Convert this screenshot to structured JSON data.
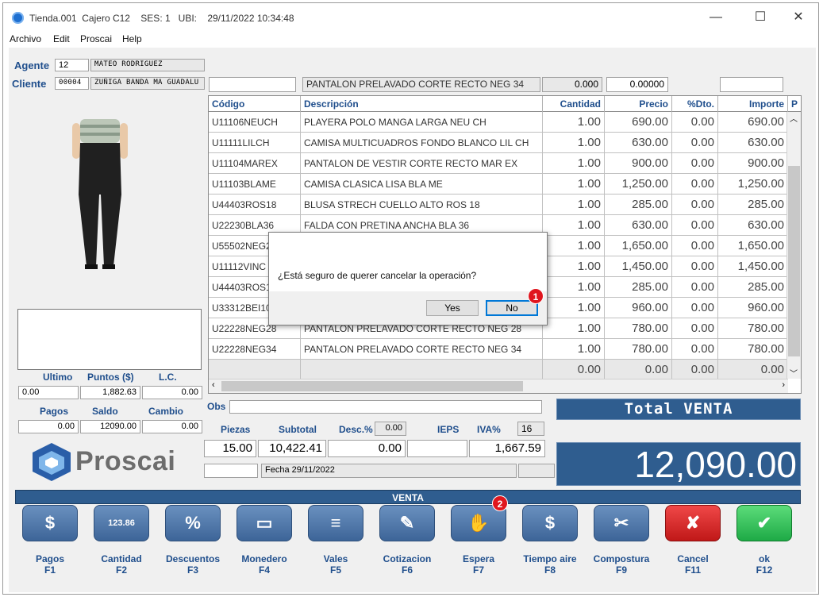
{
  "window": {
    "title": "Tienda.001  Cajero C12    SES: 1   UBI:    29/11/2022 10:34:48",
    "minimize": "—",
    "maximize": "☐",
    "close": "✕"
  },
  "menu": [
    "Archivo",
    "Edit",
    "Proscai",
    "Help"
  ],
  "agente": {
    "label": "Agente",
    "code": "12",
    "name": "MATEO RODRIGUEZ"
  },
  "cliente": {
    "label": "Cliente",
    "code": "00004",
    "name": "ZUÑIGA BANDA MA GUADALU"
  },
  "entry": {
    "code_value": "",
    "description": "PANTALON PRELAVADO CORTE RECTO NEG 34",
    "qty": "0.000",
    "price": "0.00000",
    "extra": ""
  },
  "grid": {
    "headers": [
      "Código",
      "Descripción",
      "Cantidad",
      "Precio",
      "%Dto.",
      "Importe",
      "P"
    ],
    "rows": [
      {
        "code": "U11106NEUCH",
        "desc": "PLAYERA POLO MANGA LARGA NEU CH",
        "qty": "1.00",
        "price": "690.00",
        "dto": "0.00",
        "imp": "690.00"
      },
      {
        "code": "U11111LILCH",
        "desc": "CAMISA MULTICUADROS FONDO BLANCO LIL CH",
        "qty": "1.00",
        "price": "630.00",
        "dto": "0.00",
        "imp": "630.00"
      },
      {
        "code": "U11104MAREX",
        "desc": "PANTALON DE VESTIR CORTE RECTO MAR EX",
        "qty": "1.00",
        "price": "900.00",
        "dto": "0.00",
        "imp": "900.00"
      },
      {
        "code": "U11103BLAME",
        "desc": "CAMISA CLASICA LISA BLA ME",
        "qty": "1.00",
        "price": "1,250.00",
        "dto": "0.00",
        "imp": "1,250.00"
      },
      {
        "code": "U44403ROS18",
        "desc": "BLUSA STRECH CUELLO ALTO ROS 18",
        "qty": "1.00",
        "price": "285.00",
        "dto": "0.00",
        "imp": "285.00"
      },
      {
        "code": "U22230BLA36",
        "desc": "FALDA CON PRETINA ANCHA BLA 36",
        "qty": "1.00",
        "price": "630.00",
        "dto": "0.00",
        "imp": "630.00"
      },
      {
        "code": "U55502NEG2",
        "desc": "",
        "qty": "1.00",
        "price": "1,650.00",
        "dto": "0.00",
        "imp": "1,650.00"
      },
      {
        "code": "U11112VINC",
        "desc": "",
        "qty": "1.00",
        "price": "1,450.00",
        "dto": "0.00",
        "imp": "1,450.00"
      },
      {
        "code": "U44403ROS1",
        "desc": "",
        "qty": "1.00",
        "price": "285.00",
        "dto": "0.00",
        "imp": "285.00"
      },
      {
        "code": "U33312BEI10",
        "desc": "",
        "qty": "1.00",
        "price": "960.00",
        "dto": "0.00",
        "imp": "960.00"
      },
      {
        "code": "U22228NEG28",
        "desc": "PANTALON PRELAVADO CORTE RECTO NEG 28",
        "qty": "1.00",
        "price": "780.00",
        "dto": "0.00",
        "imp": "780.00"
      },
      {
        "code": "U22228NEG34",
        "desc": "PANTALON PRELAVADO CORTE RECTO NEG 34",
        "qty": "1.00",
        "price": "780.00",
        "dto": "0.00",
        "imp": "780.00"
      },
      {
        "code": "",
        "desc": "",
        "qty": "0.00",
        "price": "0.00",
        "dto": "0.00",
        "imp": "0.00"
      }
    ]
  },
  "dialog": {
    "message": "¿Está seguro de querer cancelar la operación?",
    "yes": "Yes",
    "no": "No",
    "badge": "1"
  },
  "stats": {
    "ultimo_label": "Ultimo",
    "puntos_label": "Puntos ($)",
    "lc_label": "L.C.",
    "ultimo": "0.00",
    "puntos": "1,882.63",
    "lc": "0.00",
    "pagos_label": "Pagos",
    "saldo_label": "Saldo",
    "cambio_label": "Cambio",
    "pagos": "0.00",
    "saldo": "12090.00",
    "cambio": "0.00"
  },
  "obs_label": "Obs",
  "summary": {
    "piezas_label": "Piezas",
    "subtotal_label": "Subtotal",
    "desc_label": "Desc.%",
    "ieps_label": "IEPS",
    "iva_label": "IVA%",
    "desc_pct": "0.00",
    "iva_pct": "16",
    "piezas": "15.00",
    "subtotal": "10,422.41",
    "descuento": "0.00",
    "ieps": "",
    "iva": "1,667.59",
    "fecha": "Fecha 29/11/2022"
  },
  "total": {
    "title": "Total VENTA",
    "value": "12,090.00"
  },
  "logo_text": "Proscai",
  "venta_bar": "VENTA",
  "function_buttons": [
    {
      "label": "Pagos",
      "key": "F1",
      "icon": "$"
    },
    {
      "label": "Cantidad",
      "key": "F2",
      "icon": "123.86"
    },
    {
      "label": "Descuentos",
      "key": "F3",
      "icon": "%"
    },
    {
      "label": "Monedero",
      "key": "F4",
      "icon": "▭"
    },
    {
      "label": "Vales",
      "key": "F5",
      "icon": "≡"
    },
    {
      "label": "Cotizacion",
      "key": "F6",
      "icon": "✎"
    },
    {
      "label": "Espera",
      "key": "F7",
      "icon": "✋"
    },
    {
      "label": "Tiempo aire",
      "key": "F8",
      "icon": "$"
    },
    {
      "label": "Compostura",
      "key": "F9",
      "icon": "✂"
    },
    {
      "label": "Cancel",
      "key": "F11",
      "icon": "✘"
    },
    {
      "label": "ok",
      "key": "F12",
      "icon": "✔"
    }
  ],
  "espera_badge": "2",
  "colors": {
    "accent": "#2f5d8f",
    "label_blue": "#1f4e8c",
    "cancel_red": "#d42424",
    "ok_green": "#2cbf56",
    "badge_red": "#e0161e"
  }
}
